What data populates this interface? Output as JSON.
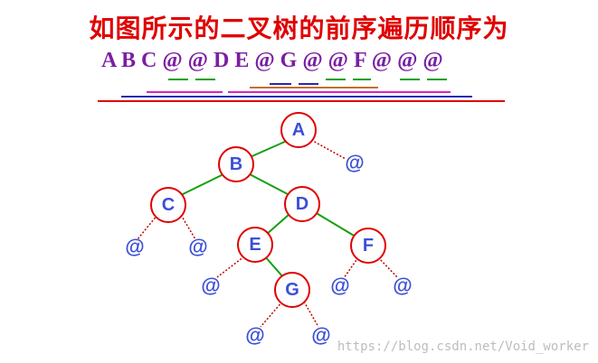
{
  "header": {
    "title": "如图所示的二叉树的前序遍历顺序为",
    "sequence": "A B C @ @ D E @ G @ @ F @ @ @"
  },
  "tree": {
    "nodes": [
      {
        "id": "A",
        "label": "A"
      },
      {
        "id": "B",
        "label": "B"
      },
      {
        "id": "C",
        "label": "C"
      },
      {
        "id": "D",
        "label": "D"
      },
      {
        "id": "E",
        "label": "E"
      },
      {
        "id": "F",
        "label": "F"
      },
      {
        "id": "G",
        "label": "G"
      }
    ],
    "null_label": "@",
    "null_count": 8
  },
  "colors": {
    "title": "#e00000",
    "sequence": "#7a1fa2",
    "node_text": "#3b4fd6",
    "node_border": "#e00000",
    "edge": "#10a010",
    "null_edge": "#c00000"
  },
  "watermark": "https://blog.csdn.net/Void_worker"
}
